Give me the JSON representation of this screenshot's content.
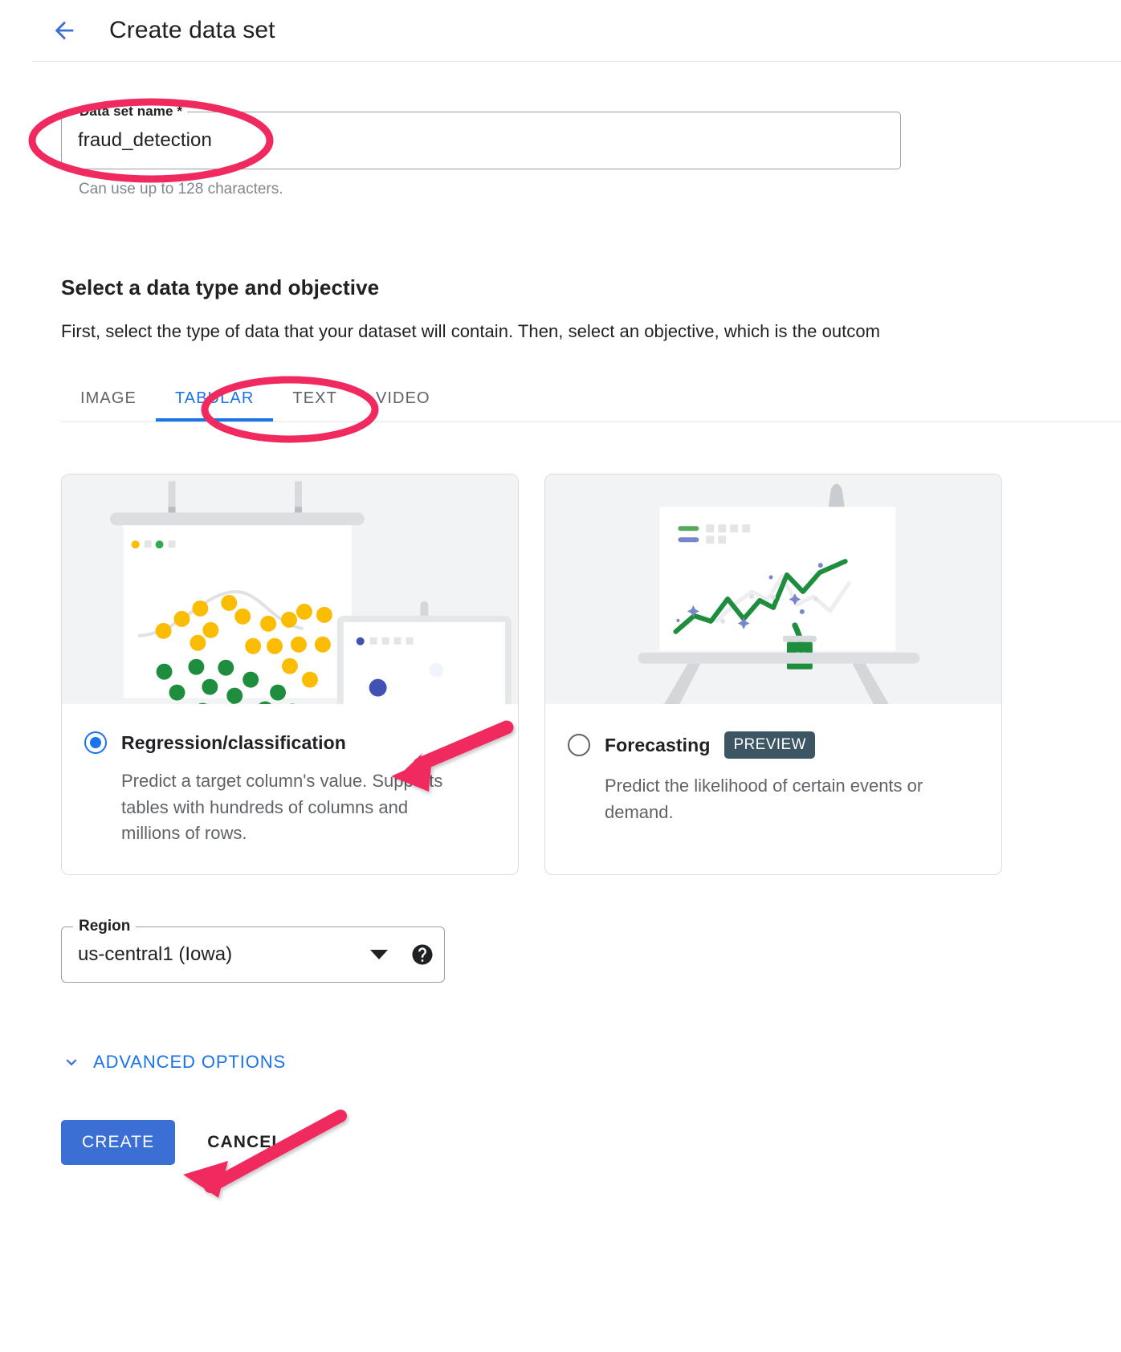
{
  "header": {
    "back_icon": "arrow-back-icon",
    "title": "Create data set"
  },
  "dataset_name_field": {
    "label": "Data set name *",
    "value": "fraud_detection",
    "hint": "Can use up to 128 characters."
  },
  "section": {
    "title": "Select a data type and objective",
    "description": "First, select the type of data that your dataset will contain. Then, select an objective, which is the outcom"
  },
  "tabs": [
    {
      "label": "IMAGE",
      "active": false
    },
    {
      "label": "TABULAR",
      "active": true
    },
    {
      "label": "TEXT",
      "active": false
    },
    {
      "label": "VIDEO",
      "active": false
    }
  ],
  "objective_cards": [
    {
      "id": "regression-classification",
      "illustration": "scatter-plot-presentation-illustration",
      "label": "Regression/classification",
      "badge": null,
      "description": "Predict a target column's value. Supports tables with hundreds of columns and millions of rows.",
      "selected": true
    },
    {
      "id": "forecasting",
      "illustration": "line-chart-easel-illustration",
      "label": "Forecasting",
      "badge": "PREVIEW",
      "description": "Predict the likelihood of certain events or demand.",
      "selected": false
    }
  ],
  "region_select": {
    "label": "Region",
    "value": "us-central1 (Iowa)",
    "dropdown_icon": "chevron-down-icon",
    "help_icon": "help-circle-icon"
  },
  "advanced_options": {
    "icon": "chevron-down-icon",
    "label": "ADVANCED OPTIONS"
  },
  "actions": {
    "create_label": "CREATE",
    "cancel_label": "CANCEL"
  },
  "colors": {
    "accent_blue": "#1a73e8",
    "primary_button": "#3b6fd4",
    "annotation_pink": "#f0295f",
    "badge_slate": "#3c5663",
    "chart_yellow": "#fbbc04",
    "chart_green": "#34a853",
    "chart_blue": "#4152b3"
  },
  "annotations": [
    {
      "type": "ellipse",
      "target": "dataset-name-field"
    },
    {
      "type": "ellipse",
      "target": "tab-tabular"
    },
    {
      "type": "arrow",
      "target": "regression-classification-radio"
    },
    {
      "type": "arrow",
      "target": "create-button"
    }
  ]
}
